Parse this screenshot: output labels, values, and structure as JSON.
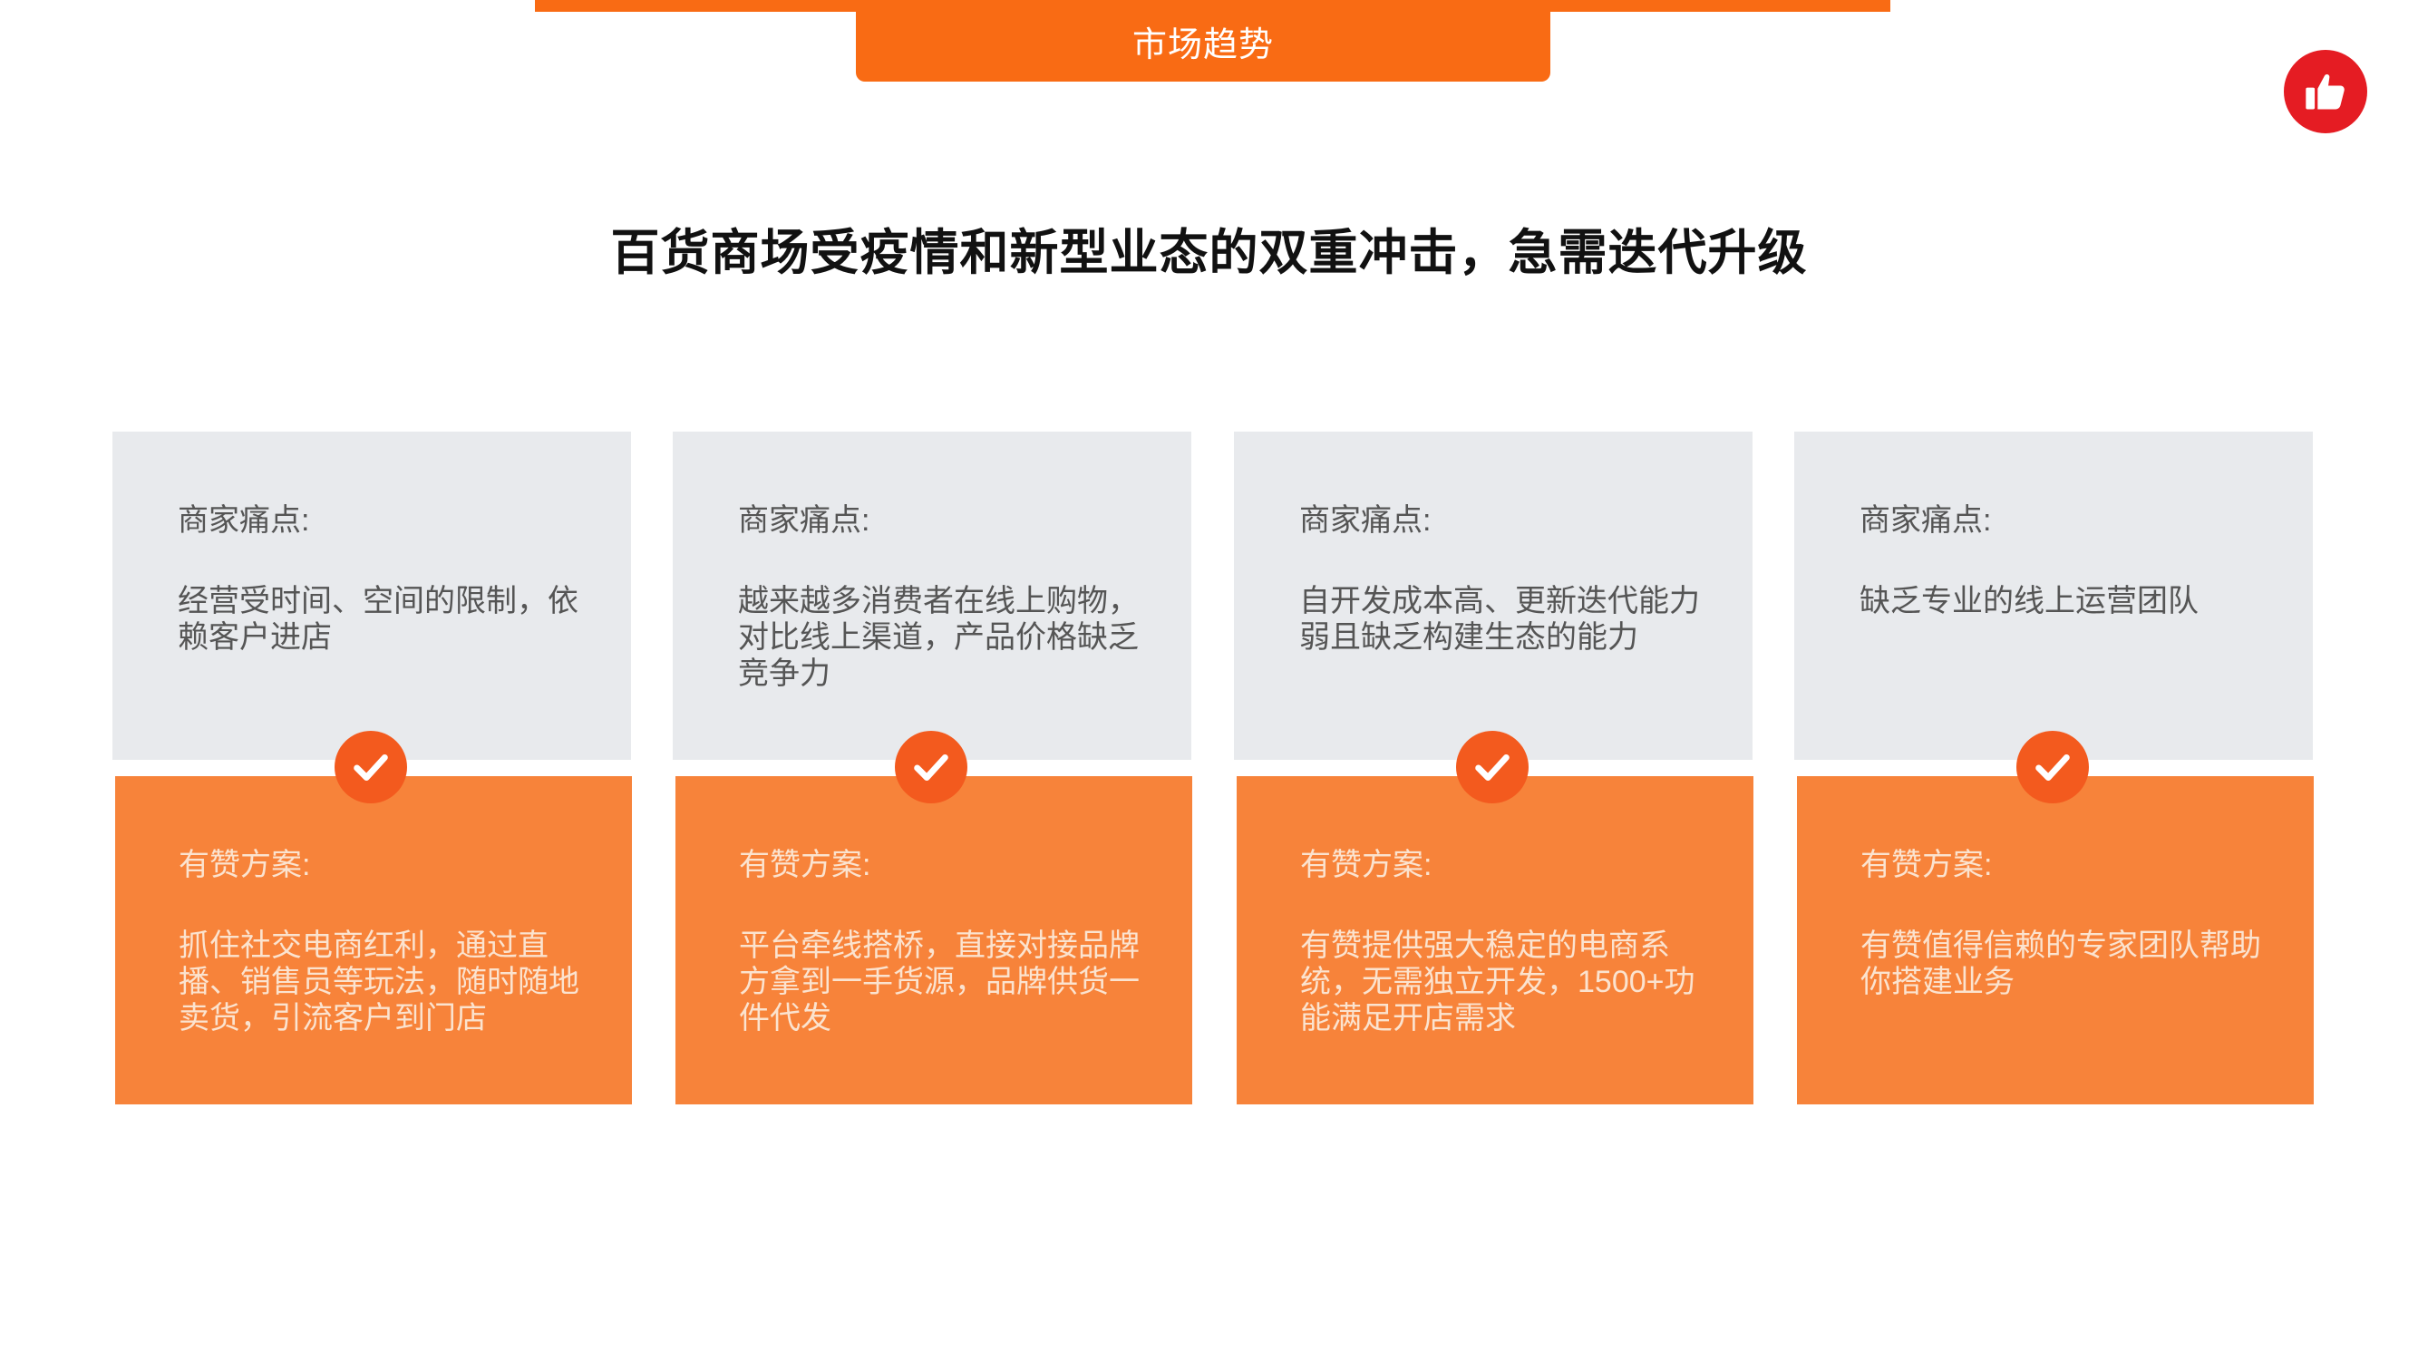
{
  "header": {
    "section_label": "市场趋势"
  },
  "headline": "百货商场受疫情和新型业态的双重冲击，急需迭代升级",
  "icons": {
    "badge": "thumbs-up-icon",
    "check": "checkmark-icon"
  },
  "colors": {
    "accent": "#f96b14",
    "solution_bg": "#f7833a",
    "pain_bg": "#e8eaed",
    "badge_red": "#e51c23"
  },
  "cards": [
    {
      "pain_label": "商家痛点:",
      "pain_text": "经营受时间、空间的限制，依赖客户进店",
      "solution_label": "有赞方案:",
      "solution_text": "抓住社交电商红利，通过直播、销售员等玩法，随时随地卖货，引流客户到门店"
    },
    {
      "pain_label": "商家痛点:",
      "pain_text": "越来越多消费者在线上购物，对比线上渠道，产品价格缺乏竞争力",
      "solution_label": "有赞方案:",
      "solution_text": "平台牵线搭桥，直接对接品牌方拿到一手货源，品牌供货一件代发"
    },
    {
      "pain_label": "商家痛点:",
      "pain_text": "自开发成本高、更新迭代能力弱且缺乏构建生态的能力",
      "solution_label": "有赞方案:",
      "solution_text": "有赞提供强大稳定的电商系统，无需独立开发，1500+功能满足开店需求"
    },
    {
      "pain_label": "商家痛点:",
      "pain_text": "缺乏专业的线上运营团队",
      "solution_label": "有赞方案:",
      "solution_text": "有赞值得信赖的专家团队帮助你搭建业务"
    }
  ]
}
